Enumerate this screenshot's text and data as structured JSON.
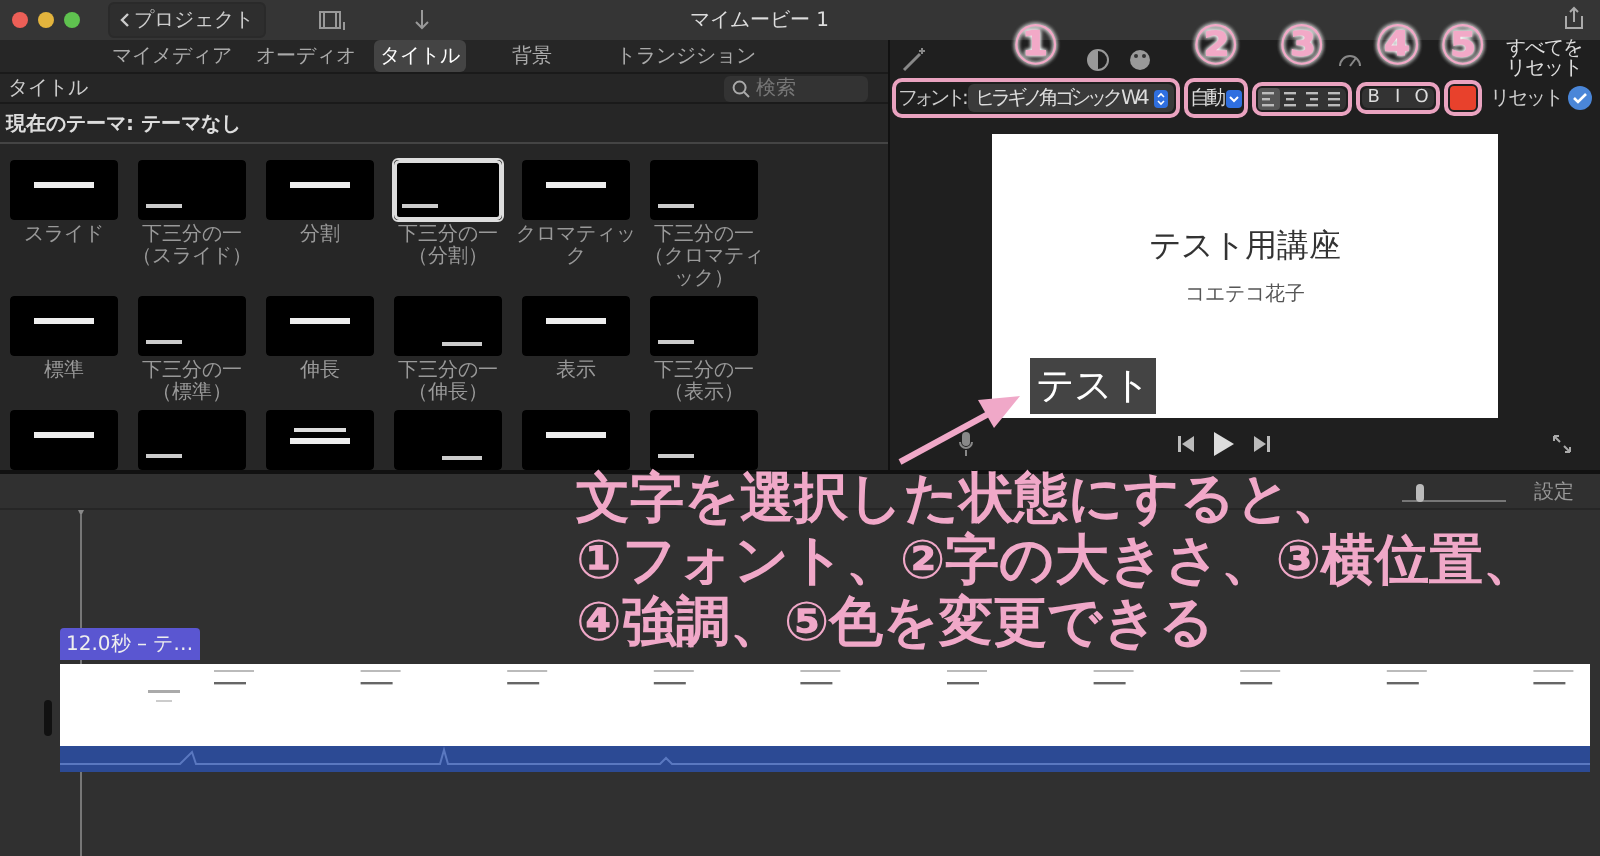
{
  "window": {
    "title": "マイムービー 1",
    "back_button": "プロジェクト"
  },
  "browser_tabs": [
    {
      "label": "マイメディア",
      "selected": false
    },
    {
      "label": "オーディオ",
      "selected": false
    },
    {
      "label": "タイトル",
      "selected": true
    },
    {
      "label": "背景",
      "selected": false
    },
    {
      "label": "トランジション",
      "selected": false
    }
  ],
  "browser": {
    "heading": "タイトル",
    "search": {
      "placeholder": "検索"
    },
    "theme": "現在のテーマ: テーマなし"
  },
  "titles": [
    {
      "label": "スライド",
      "kind": "center",
      "selected": false
    },
    {
      "label": "下三分の一（スライド）",
      "kind": "lower",
      "selected": false
    },
    {
      "label": "分割",
      "kind": "center",
      "selected": false
    },
    {
      "label": "下三分の一（分割）",
      "kind": "lower",
      "selected": true
    },
    {
      "label": "クロマティック",
      "kind": "center",
      "selected": false
    },
    {
      "label": "下三分の一（クロマティック）",
      "kind": "lower",
      "selected": false
    },
    {
      "label": "標準",
      "kind": "center",
      "selected": false
    },
    {
      "label": "下三分の一（標準）",
      "kind": "lower",
      "selected": false
    },
    {
      "label": "伸長",
      "kind": "center",
      "selected": false
    },
    {
      "label": "下三分の一（伸長）",
      "kind": "lowright",
      "selected": false
    },
    {
      "label": "表示",
      "kind": "center",
      "selected": false
    },
    {
      "label": "下三分の一（表示）",
      "kind": "lower",
      "selected": false
    },
    {
      "kind": "center",
      "selected": false
    },
    {
      "kind": "lower",
      "selected": false
    },
    {
      "kind": "double",
      "selected": false
    },
    {
      "kind": "lowright",
      "selected": false
    },
    {
      "kind": "center",
      "selected": false
    },
    {
      "kind": "lower",
      "selected": false
    }
  ],
  "inspector": {
    "reset_all": "すべてをリセット",
    "font_label": "フォント:",
    "font": "ヒラギノ角ゴシック W4",
    "size": "自動",
    "alignment": [
      {
        "selected": true
      },
      {
        "selected": false
      },
      {
        "selected": false
      },
      {
        "selected": false
      }
    ],
    "styles": [
      {
        "label": "B",
        "on": false
      },
      {
        "label": "I",
        "on": false
      },
      {
        "label": "O",
        "on": false
      }
    ],
    "color": "#e8412c",
    "reset": "リセット",
    "applied": true
  },
  "preview": {
    "title": "テスト用講座",
    "subtitle": "コエテコ花子",
    "selected_text": "テスト"
  },
  "timeline": {
    "settings": "設定",
    "zoom": {
      "level": 0.15
    },
    "clip_label": "12.0秒 – テ…"
  },
  "annotations": {
    "markers": [
      "①",
      "②",
      "③",
      "④",
      "⑤"
    ],
    "callout": [
      "文字を選択した状態にすると、",
      "①フォント、②字の大きさ、③横位置、",
      "④強調、⑤色を変更できる"
    ]
  }
}
